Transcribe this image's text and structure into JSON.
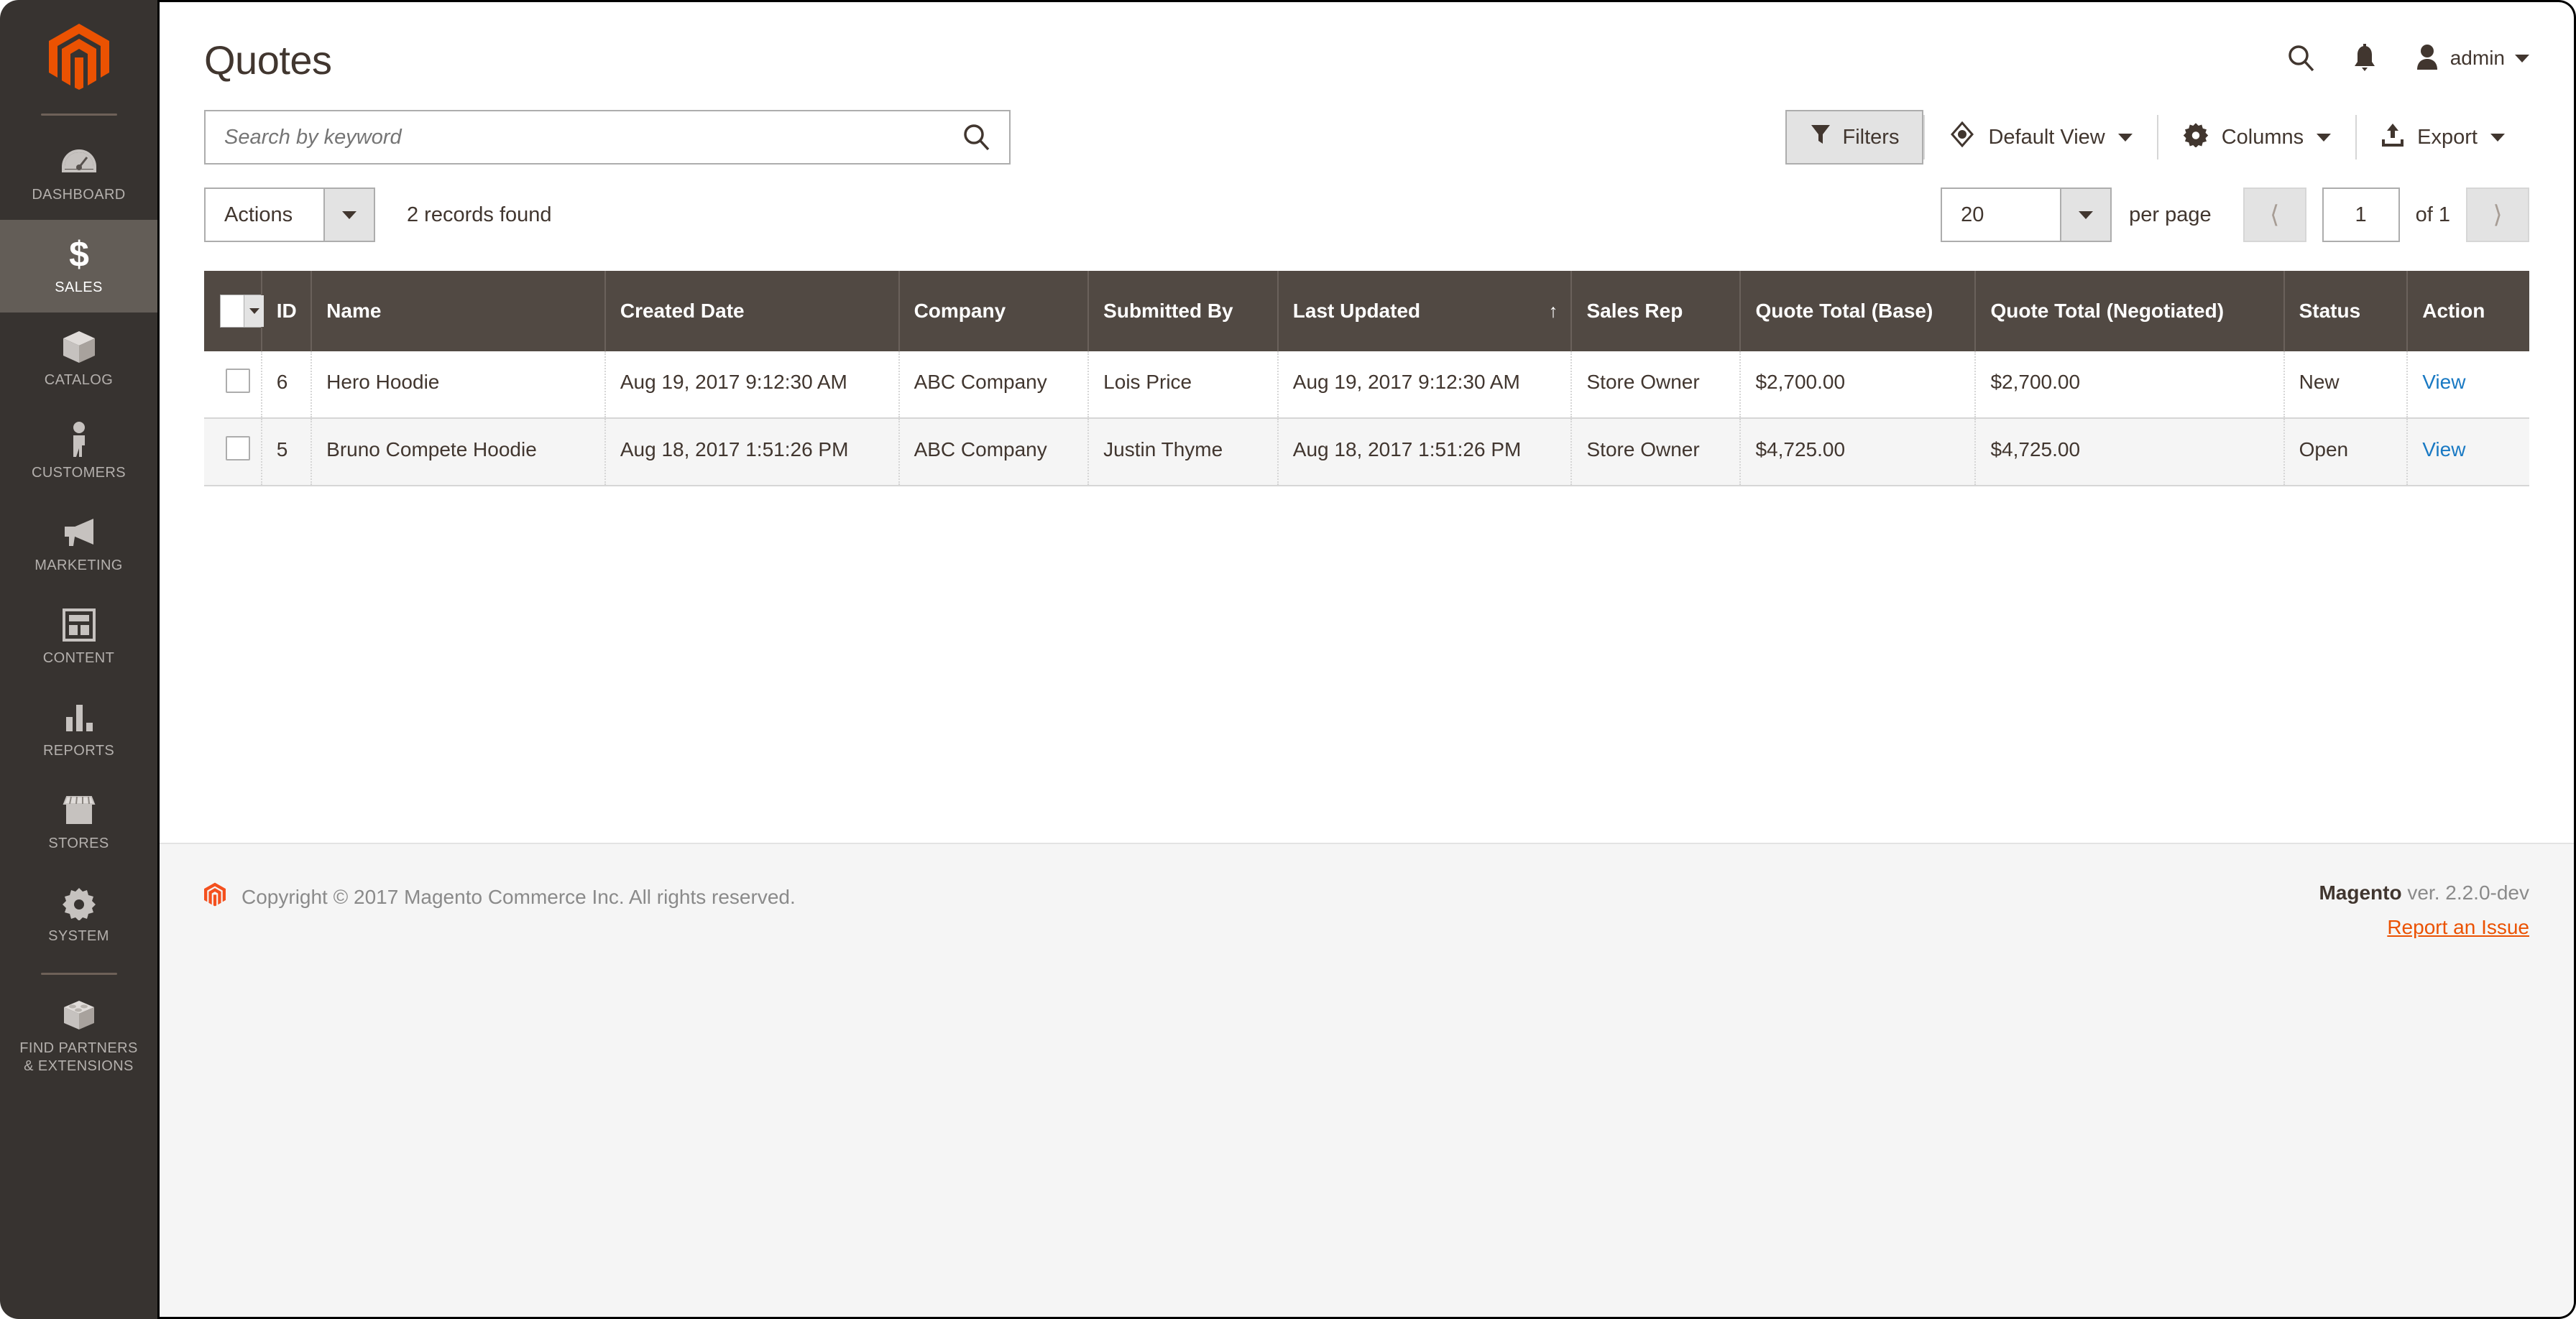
{
  "sidebar": {
    "logo_alt": "magento-logo",
    "items": [
      {
        "label": "DASHBOARD",
        "icon": "dashboard-icon",
        "active": false
      },
      {
        "label": "SALES",
        "icon": "dollar-icon",
        "active": true
      },
      {
        "label": "CATALOG",
        "icon": "box-icon",
        "active": false
      },
      {
        "label": "CUSTOMERS",
        "icon": "person-icon",
        "active": false
      },
      {
        "label": "MARKETING",
        "icon": "megaphone-icon",
        "active": false
      },
      {
        "label": "CONTENT",
        "icon": "layout-icon",
        "active": false
      },
      {
        "label": "REPORTS",
        "icon": "bar-chart-icon",
        "active": false
      },
      {
        "label": "STORES",
        "icon": "storefront-icon",
        "active": false
      },
      {
        "label": "SYSTEM",
        "icon": "gear-icon",
        "active": false
      },
      {
        "label": "FIND PARTNERS\n& EXTENSIONS",
        "icon": "extension-icon",
        "active": false
      }
    ]
  },
  "header": {
    "title": "Quotes",
    "search_icon": "search-icon",
    "notifications_icon": "bell-icon",
    "avatar_icon": "user-icon",
    "admin_label": "admin"
  },
  "search": {
    "placeholder": "Search by keyword",
    "value": "",
    "icon": "search-icon"
  },
  "toolbar": {
    "filters_label": "Filters",
    "filters_icon": "funnel-icon",
    "view_label": "Default View",
    "view_icon": "eye-icon",
    "columns_label": "Columns",
    "columns_icon": "gear-icon",
    "export_label": "Export",
    "export_icon": "upload-icon"
  },
  "subbar": {
    "actions_label": "Actions",
    "records_found": "2 records found",
    "per_page_value": "20",
    "per_page_label": "per page",
    "prev_icon": "chevron-left-icon",
    "next_icon": "chevron-right-icon",
    "page_value": "1",
    "of_label": "of 1"
  },
  "grid": {
    "columns": [
      {
        "label": "",
        "key": "check"
      },
      {
        "label": "ID",
        "key": "id"
      },
      {
        "label": "Name",
        "key": "name"
      },
      {
        "label": "Created Date",
        "key": "created"
      },
      {
        "label": "Company",
        "key": "company"
      },
      {
        "label": "Submitted By",
        "key": "submitted_by"
      },
      {
        "label": "Last Updated",
        "key": "updated",
        "sorted": "asc"
      },
      {
        "label": "Sales Rep",
        "key": "sales_rep"
      },
      {
        "label": "Quote Total (Base)",
        "key": "total_base"
      },
      {
        "label": "Quote Total (Negotiated)",
        "key": "total_negotiated"
      },
      {
        "label": "Status",
        "key": "status"
      },
      {
        "label": "Action",
        "key": "action"
      }
    ],
    "rows": [
      {
        "id": "6",
        "name": "Hero Hoodie",
        "created": "Aug 19, 2017 9:12:30 AM",
        "company": "ABC Company",
        "submitted_by": "Lois Price",
        "updated": "Aug 19, 2017 9:12:30 AM",
        "sales_rep": "Store Owner",
        "total_base": "$2,700.00",
        "total_negotiated": "$2,700.00",
        "status": "New",
        "action": "View"
      },
      {
        "id": "5",
        "name": "Bruno Compete Hoodie",
        "created": "Aug 18, 2017 1:51:26 PM",
        "company": "ABC Company",
        "submitted_by": "Justin Thyme",
        "updated": "Aug 18, 2017 1:51:26 PM",
        "sales_rep": "Store Owner",
        "total_base": "$4,725.00",
        "total_negotiated": "$4,725.00",
        "status": "Open",
        "action": "View"
      }
    ]
  },
  "footer": {
    "copyright": "Copyright © 2017 Magento Commerce Inc. All rights reserved.",
    "brand": "Magento",
    "version": " ver. 2.2.0-dev",
    "report_link": "Report an Issue"
  },
  "colors": {
    "accent": "#eb5202",
    "sidebar_bg": "#373330",
    "header_row_bg": "#514943",
    "link": "#1979c3"
  }
}
